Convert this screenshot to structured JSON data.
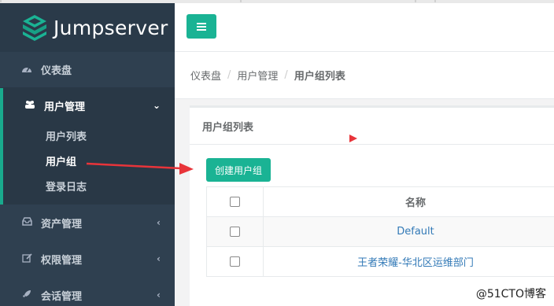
{
  "app": {
    "name": "Jumpserver"
  },
  "sidebar": {
    "items": [
      {
        "label": "仪表盘",
        "icon": "dashboard-icon"
      },
      {
        "label": "用户管理",
        "icon": "users-icon",
        "expanded": true,
        "children": [
          {
            "label": "用户列表"
          },
          {
            "label": "用户组"
          },
          {
            "label": "登录日志"
          }
        ]
      },
      {
        "label": "资产管理",
        "icon": "inbox-icon"
      },
      {
        "label": "权限管理",
        "icon": "edit-icon"
      },
      {
        "label": "会话管理",
        "icon": "rocket-icon"
      }
    ]
  },
  "breadcrumb": {
    "items": [
      "仪表盘",
      "用户管理",
      "用户组列表"
    ]
  },
  "panel": {
    "title": "用户组列表",
    "create_label": "创建用户组",
    "table": {
      "headers": [
        "名称"
      ],
      "rows": [
        {
          "name": "Default"
        },
        {
          "name": "王者荣耀-华北区运维部门"
        }
      ]
    }
  },
  "watermark": "@51CTO博客",
  "colors": {
    "accent": "#1ab394",
    "sidebar": "#2f4050",
    "link": "#337ab7",
    "annotation": "#e8343a"
  }
}
